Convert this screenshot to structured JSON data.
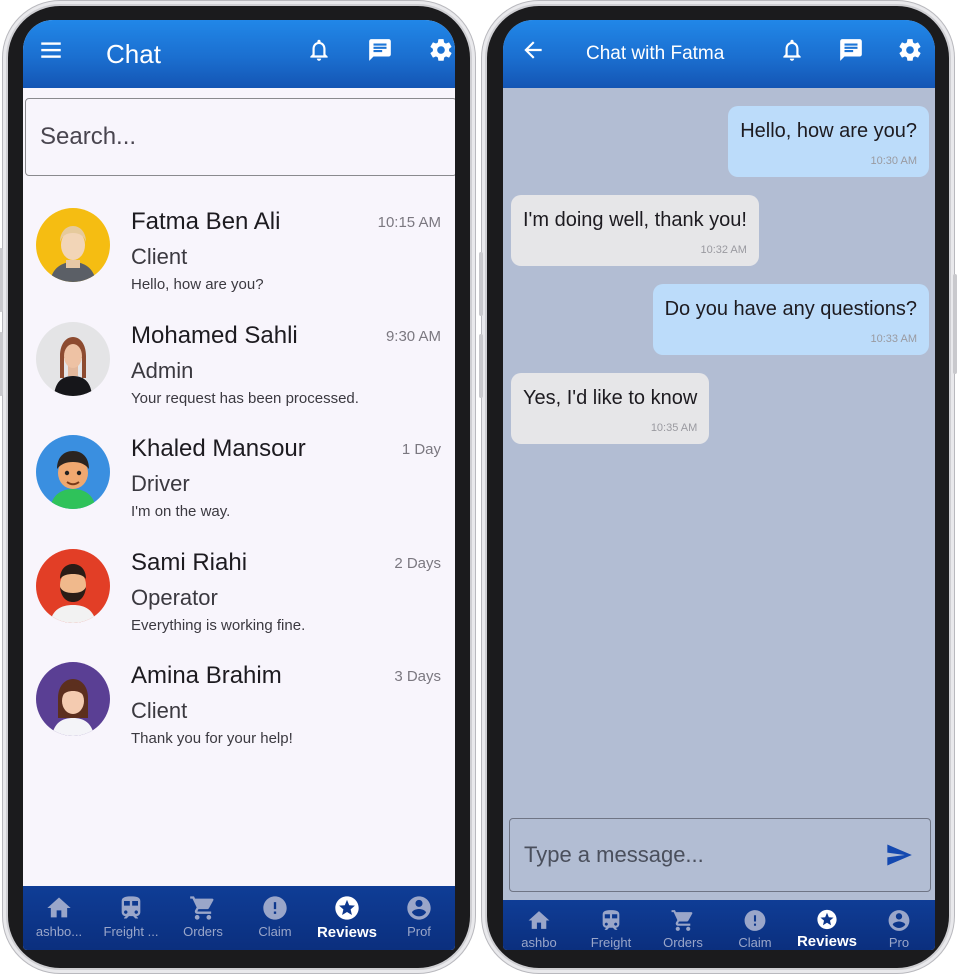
{
  "left_screen": {
    "appbar": {
      "title": "Chat"
    },
    "search": {
      "placeholder": "Search..."
    },
    "chats": [
      {
        "name": "Fatma Ben Ali",
        "role": "Client",
        "message": "Hello, how are you?",
        "time": "10:15 AM",
        "avatar": "avatar-fatma"
      },
      {
        "name": "Mohamed Sahli",
        "role": "Admin",
        "message": "Your request has been processed.",
        "time": "9:30 AM",
        "avatar": "avatar-mohamed"
      },
      {
        "name": "Khaled Mansour",
        "role": "Driver",
        "message": "I'm on the way.",
        "time": "1 Day",
        "avatar": "avatar-khaled"
      },
      {
        "name": "Sami Riahi",
        "role": "Operator",
        "message": "Everything is working fine.",
        "time": "2 Days",
        "avatar": "avatar-sami"
      },
      {
        "name": "Amina Brahim",
        "role": "Client",
        "message": "Thank you for your help!",
        "time": "3 Days",
        "avatar": "avatar-amina"
      }
    ],
    "bottom_nav": [
      {
        "label": "ashbo...",
        "icon": "home-icon"
      },
      {
        "label": "Freight ...",
        "icon": "train-icon"
      },
      {
        "label": "Orders",
        "icon": "cart-icon"
      },
      {
        "label": "Claim",
        "icon": "alert-icon"
      },
      {
        "label": "Reviews",
        "icon": "star-icon",
        "active": true
      },
      {
        "label": "Prof",
        "icon": "account-icon"
      }
    ]
  },
  "right_screen": {
    "appbar": {
      "title": "Chat with Fatma"
    },
    "messages": [
      {
        "text": "Hello, how are you?",
        "time": "10:30 AM",
        "direction": "out"
      },
      {
        "text": "I'm doing well, thank you!",
        "time": "10:32 AM",
        "direction": "in"
      },
      {
        "text": "Do you have any questions?",
        "time": "10:33 AM",
        "direction": "out"
      },
      {
        "text": "Yes, I'd like to know",
        "time": "10:35 AM",
        "direction": "in"
      }
    ],
    "composer": {
      "placeholder": "Type a message..."
    },
    "bottom_nav": [
      {
        "label": "ashbo",
        "icon": "home-icon"
      },
      {
        "label": "Freight",
        "icon": "train-icon"
      },
      {
        "label": "Orders",
        "icon": "cart-icon"
      },
      {
        "label": "Claim",
        "icon": "alert-icon"
      },
      {
        "label": "Reviews",
        "icon": "star-icon",
        "active": true
      },
      {
        "label": "Pro",
        "icon": "account-icon"
      }
    ]
  },
  "colors": {
    "appbar_blue": "#1b6fd0",
    "nav_dark_blue": "#0f3d96",
    "outgoing_bubble": "#bcdcfa",
    "incoming_bubble": "#e6e6e8",
    "conversation_bg": "#b2bdd3"
  }
}
